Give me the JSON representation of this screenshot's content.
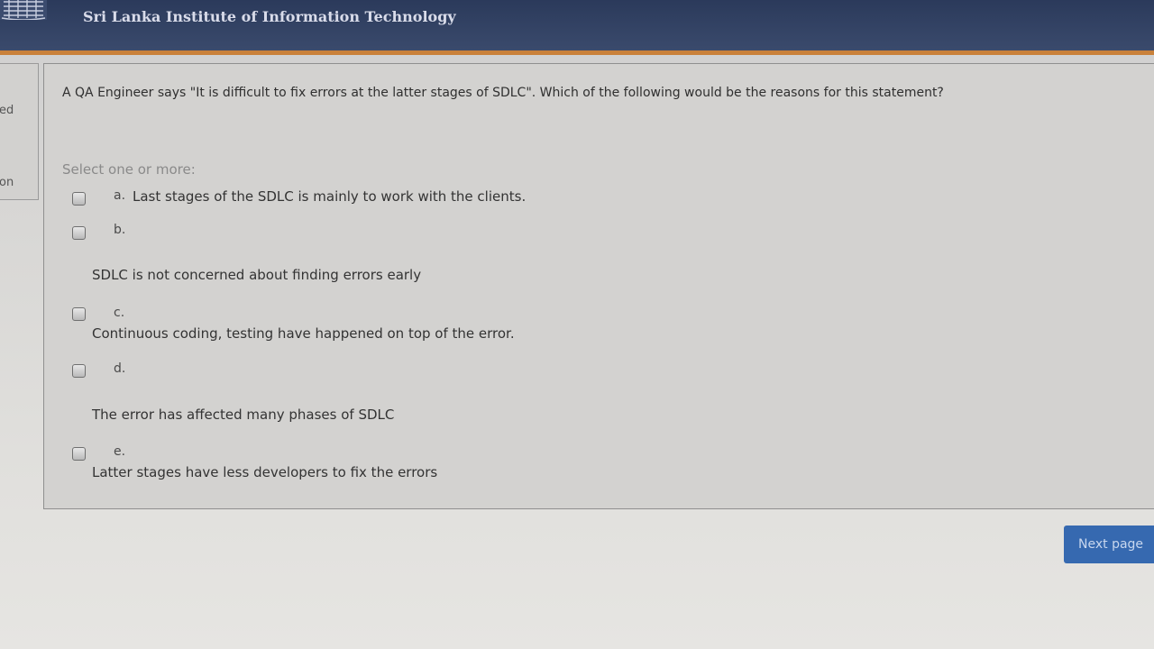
{
  "header": {
    "site_title": "Sri Lanka Institute of Information Technology"
  },
  "side": {
    "text1": "ed",
    "text2": "on"
  },
  "question": {
    "text": "A QA Engineer says \"It is difficult to fix errors at the latter stages of SDLC\". Which of the following would be the reasons for this statement?",
    "prompt": "Select one or more:",
    "options": [
      {
        "letter": "a.",
        "text": "Last stages of the SDLC is mainly to work with the clients."
      },
      {
        "letter": "b.",
        "text": "SDLC is not concerned about finding errors early"
      },
      {
        "letter": "c.",
        "text": "Continuous coding, testing have happened on top of the error."
      },
      {
        "letter": "d.",
        "text": "The error has affected many phases of SDLC"
      },
      {
        "letter": "e.",
        "text": "Latter stages have less developers to fix the errors"
      }
    ]
  },
  "navigation": {
    "next_label": "Next page"
  }
}
